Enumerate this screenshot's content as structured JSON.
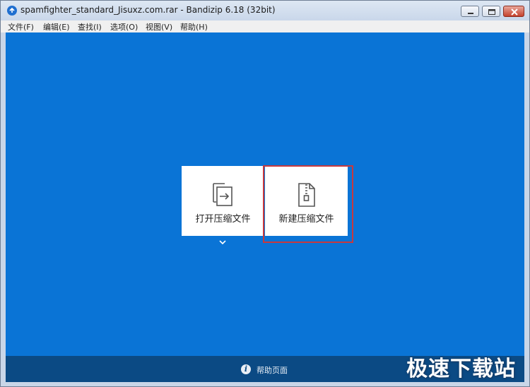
{
  "window": {
    "title": "spamfighter_standard_Jisuxz.com.rar - Bandizip 6.18 (32bit)"
  },
  "menu": {
    "items": [
      "文件(F)",
      "编辑(E)",
      "查找(I)",
      "选项(O)",
      "视图(V)",
      "帮助(H)"
    ]
  },
  "main": {
    "cards": [
      {
        "label": "打开压缩文件",
        "icon": "open-archive-icon"
      },
      {
        "label": "新建压缩文件",
        "icon": "zip-file-icon"
      }
    ],
    "dropdown_icon": "chevron-down-icon"
  },
  "footer": {
    "help_label": "帮助页面",
    "help_icon": "info-icon"
  },
  "watermark": {
    "text": "极速下载站"
  },
  "colors": {
    "client_bg": "#0a74d6",
    "footer_bg": "#0b4a84",
    "highlight": "#c8393e"
  }
}
